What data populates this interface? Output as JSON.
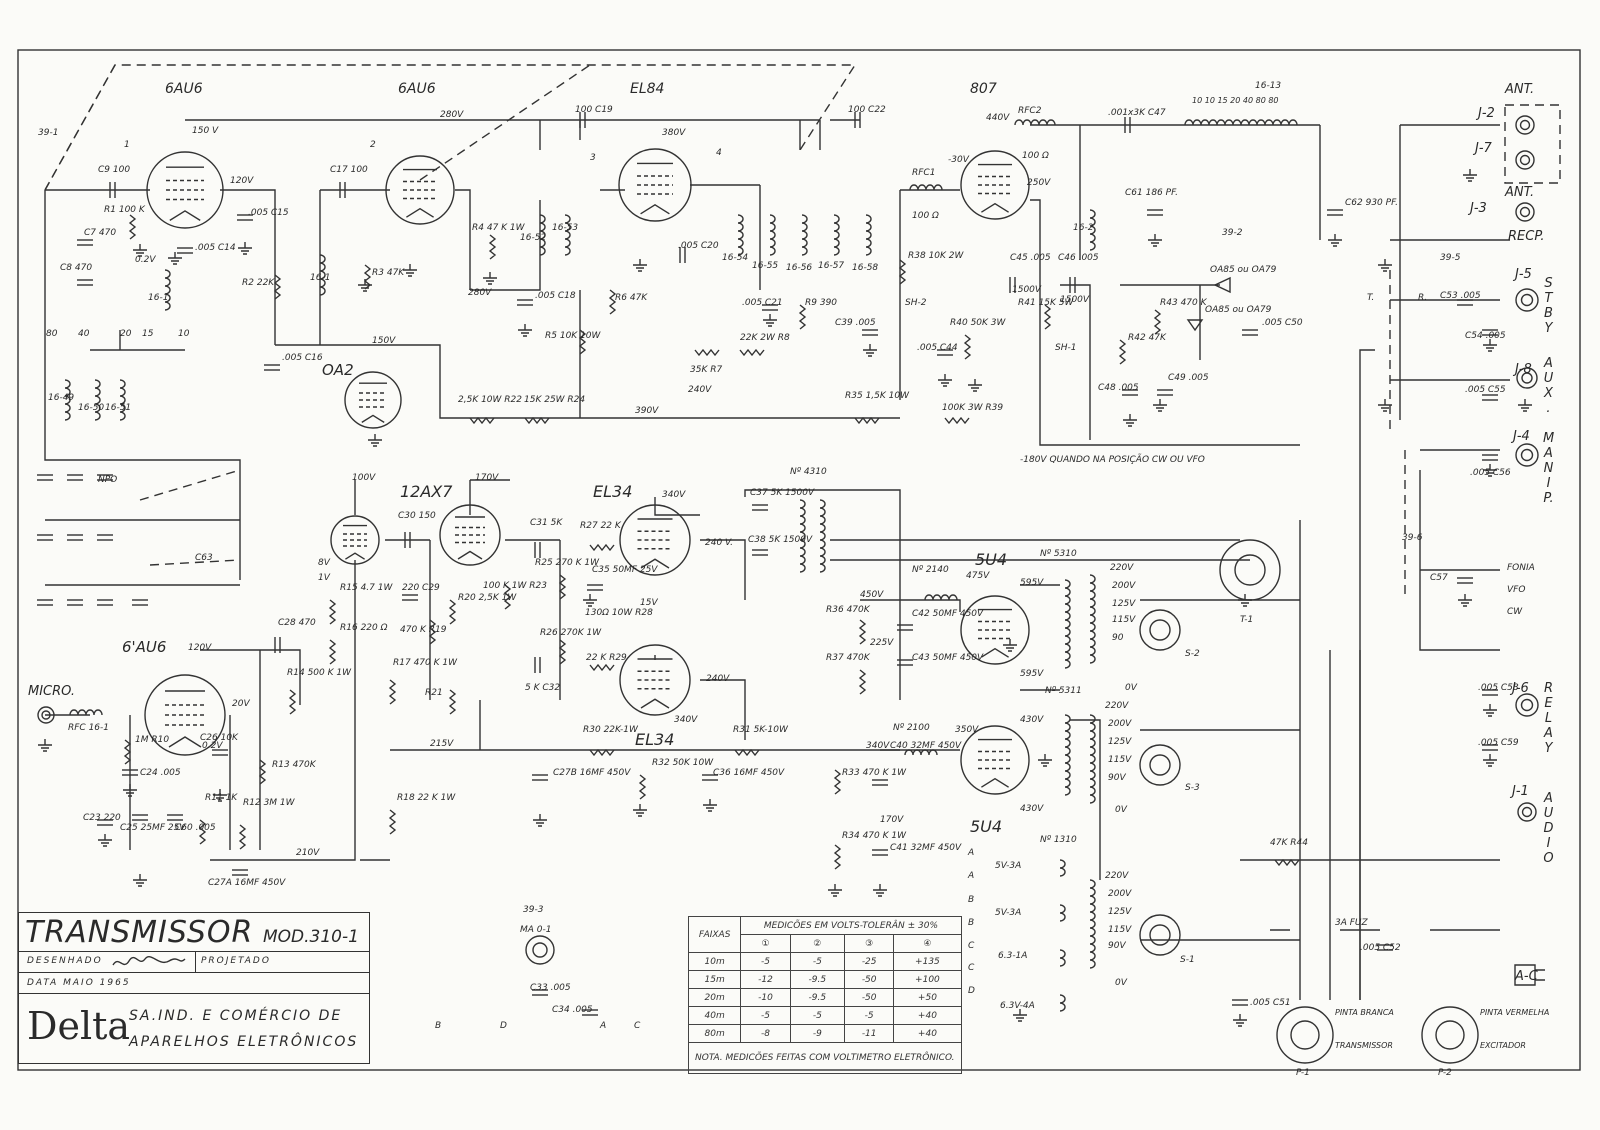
{
  "title_block": {
    "title": "TRANSMISSOR",
    "model": "MOD.310-1",
    "drawn_label": "DESENHADO",
    "designed_label": "PROJETADO",
    "date": "DATA  MAIO 1965",
    "logo": "Delta",
    "company_line1": "SA.IND. E COMÉRCIO DE",
    "company_line2": "APARELHOS ELETRÔNICOS"
  },
  "measurements_table": {
    "band_header": "FAIXAS",
    "group_header": "MEDICÕES EM VOLTS-TOLERÂN ± 30%",
    "columns": [
      "①",
      "②",
      "③",
      "④"
    ],
    "rows": [
      {
        "band": "10m",
        "values": [
          "-5",
          "-5",
          "-25",
          "+135"
        ]
      },
      {
        "band": "15m",
        "values": [
          "-12",
          "-9.5",
          "-50",
          "+100"
        ]
      },
      {
        "band": "20m",
        "values": [
          "-10",
          "-9.5",
          "-50",
          "+50"
        ]
      },
      {
        "band": "40m",
        "values": [
          "-5",
          "-5",
          "-5",
          "+40"
        ]
      },
      {
        "band": "80m",
        "values": [
          "-8",
          "-9",
          "-11",
          "+40"
        ]
      }
    ],
    "note": "NOTA. MEDICÕES FEITAS COM VOLTIMETRO ELETRÔNICO."
  },
  "labels": {
    "v1": "6AU6",
    "v2": "6AU6",
    "v3": "EL84",
    "v4": "807",
    "oa2": "OA2",
    "v6": "12AX7",
    "v7": "EL34",
    "v8": "EL34",
    "v9": "6'AU6",
    "u1": "5U4",
    "u2": "5U4",
    "p1": "1",
    "p2": "2",
    "p3": "3",
    "p4": "4",
    "s391": "39-1",
    "s392": "39-2",
    "s393": "39-3",
    "s395": "39-5",
    "s396": "39-6",
    "e150": "150 V",
    "e120": "120V",
    "e280": "280V",
    "e380": "380V",
    "e440": "440V",
    "e250": "250V",
    "em30": "-30V",
    "e02": "0.2V",
    "e150b": "150V",
    "e390": "390V",
    "e280b": "280V",
    "e240": "240V",
    "e100": "100V",
    "e170": "170V",
    "e340": "340V",
    "e240b": "240 V.",
    "e15": "15V",
    "e240c": "240V",
    "e340b": "340V",
    "e215": "215V",
    "e210": "210V",
    "e120b": "120V",
    "e20": "20V",
    "e02b": "0.2V",
    "e450": "450V",
    "e225": "225V",
    "e475": "475V",
    "e350": "350V",
    "e340c": "340V",
    "e170b": "170V",
    "e1500a": "1500V",
    "e1500b": "1500V",
    "e8v": "8V",
    "e1v": "1V",
    "note180": "-180V QUANDO NA POSIÇÃO CW OU VFO",
    "t4310": "Nº 4310",
    "t5310": "Nº 5310",
    "t2140": "Nº 2140",
    "t5311": "Nº 5311",
    "t2100": "Nº 2100",
    "t1310": "Nº 1310",
    "ant1": "ANT.",
    "j2": "J-2",
    "j7": "J-7",
    "j3": "J-3",
    "ant2": "ANT.",
    "recp": "RECP.",
    "j5": "J-5",
    "stby": "STBY",
    "j8": "J-8",
    "aux": "AUX.",
    "j4": "J-4",
    "manip": "MANIP.",
    "j6": "J-6",
    "relay": "RELAY",
    "j1": "J-1",
    "audio": "AUDIO",
    "ac": "A-C",
    "fonia": "FONIA",
    "vfo": "VFO",
    "cw": "CW",
    "sw_t": "T.",
    "sw_r": "R.",
    "micro": "MICRO.",
    "t1": "T-1",
    "s1": "S-1",
    "s2": "S-2",
    "s3": "S-3",
    "pinta_b": "PINTA BRANCA",
    "transm": "TRANSMISSOR",
    "pinta_v": "PINTA VERMELHA",
    "excit": "EXCITADOR",
    "pp1": "P-1",
    "pp2": "P-2",
    "coil1613": "16-13",
    "taps": "10  10  15  20  40  80  80",
    "ma": "MA 0-1",
    "sw_b": "B",
    "sw_d": "D",
    "sw_a": "A",
    "sw_c": "C",
    "rfc1": "RFC1",
    "rfc2": "RFC2",
    "r100o": "100 Ω",
    "r100o2": "100 Ω",
    "c19": "100 C19",
    "c22": "100 C22",
    "c47": ".001x3K C47",
    "c61": "C61 186 PF.",
    "c62": "C62 930 PF.",
    "oa85": "OA85 ou OA79",
    "oa85b": "OA85 ou OA79",
    "c50": ".005 C50",
    "c53": "C53 .005",
    "c54": "C54 .005",
    "c55": ".005 C55",
    "c56": ".005 C56",
    "c57": "C57",
    "c58": ".005 C58",
    "c59": ".005 C59",
    "c9": "C9 100",
    "r1": "R1 100 K",
    "c7": "C7 470",
    "c8": "C8 470",
    "c15": ".005 C15",
    "c14": ".005 C14",
    "r2": "R2 22K",
    "c16": ".005 C16",
    "c17": "C17 100",
    "r3": "R3 47K",
    "r4": "R4 47 K 1W",
    "c18": ".005 C18",
    "r5": "R5 10K 10W",
    "r6": "R6 47K",
    "c20": ".005 C20",
    "c21": ".005 C21",
    "r7": "35K R7",
    "r8": "22K 2W R8",
    "r9": "R9 390",
    "r22": "2,5K 10W R22",
    "r24": "15K 25W R24",
    "r35": "R35 1,5K 10W",
    "r39": "100K 3W R39",
    "r38": "R38 10K 2W",
    "c39": "C39 .005",
    "c44": ".005 C44",
    "r40": "R40 50K 3W",
    "r41": "R41 15K 5W",
    "c45": "C45 .005",
    "c46": "C46 .005",
    "r42": "R42 47K",
    "r43": "R43 470 K",
    "c48": "C48 .005",
    "c49": "C49 .005",
    "sh1": "SH-1",
    "sh2": "SH-2",
    "c30": "C30 150",
    "c29": "220 C29",
    "r19": "470 K R19",
    "r20": "R20 2,5K 1W",
    "r21": "R21",
    "r23": "100 K 1W R23",
    "c31": "C31 5K",
    "r25": "R25 270 K 1W",
    "r27": "R27 22 K",
    "c35": "C35 50MF 25V",
    "r28": "130Ω 10W R28",
    "r26": "R26 270K 1W",
    "r29": "22 K R29",
    "c32": "5 K C32",
    "c37": "C37 5K 1500V",
    "c38": "C38 5K 1500V",
    "r15": "R15 4.7 1W",
    "r16": "R16 220 Ω",
    "c28": "C28 470",
    "r14": "R14 500 K 1W",
    "r17": "R17 470 K 1W",
    "r18": "R18 22 K 1W",
    "r13": "R13 470K",
    "r30": "R30 22K-1W",
    "r31": "R31 5K-10W",
    "c27b": "C27B 16MF 450V",
    "r32": "R32 50K 10W",
    "c36": "C36 16MF 450V",
    "r36": "R36 470K",
    "r37": "R37 470K",
    "c42": "C42 50MF 450V",
    "c43": "C43 50MF 450V",
    "r33": "R33 470 K 1W",
    "r34": "R34 470 K 1W",
    "c40": "C40 32MF 450V",
    "c41": "C41 32MF 450V",
    "rfc16": "RFC 16-1",
    "r10": "1M R10",
    "c24": "C24 .005",
    "c26": "C26 10K",
    "c23": "C23 220",
    "c25": "C25 25MF 25V",
    "c60": "C60 .005",
    "r11": "R11 1K",
    "r12": "R12 3M 1W",
    "c27a": "C27A 16MF 450V",
    "r44": "47K R44",
    "fuz": "3A FUZ",
    "c52": ".005 C52",
    "c51": ".005 C51",
    "c33": "C33 .005",
    "c34": "C34 .005",
    "bs80": "80",
    "bs40": "40",
    "bs20": "20",
    "bs15": "15",
    "bs10": "10",
    "c63": "C63",
    "npo": "NPO",
    "tap220a": "220V",
    "tap200a": "200V",
    "tap125a": "125V",
    "tap115a": "115V",
    "tap90a": "90",
    "tap0a": "0V",
    "tap220b": "220V",
    "tap200b": "200V",
    "tap125b": "125V",
    "tap115b": "115V",
    "tap90b": "90V",
    "tap0b": "0V",
    "tap220c": "220V",
    "tap200c": "200V",
    "tap125c": "125V",
    "tap115c": "115V",
    "tap90c": "90V",
    "tap0c": "0V",
    "hv595a": "595V",
    "hv595b": "595V",
    "hv430a": "430V",
    "hv430b": "430V",
    "fil1": "5V-3A",
    "fil2": "5V-3A",
    "fil3": "6.3-1A",
    "fil4": "6.3V-4A",
    "fa1": "A",
    "fa2": "A",
    "fb1": "B",
    "fb2": "B",
    "fc1": "C",
    "fc2": "C",
    "fd": "D",
    "l1654": "16-54",
    "l1655": "16-55",
    "l1656": "16-56",
    "l1657": "16-57",
    "l1658": "16-58",
    "l1652": "16-52",
    "l1653": "16-53",
    "l161a": "16-1",
    "l161b": "16-1",
    "l162": "16-2",
    "l1649": "16-49",
    "l1650": "16-50",
    "l1651": "16-51"
  }
}
